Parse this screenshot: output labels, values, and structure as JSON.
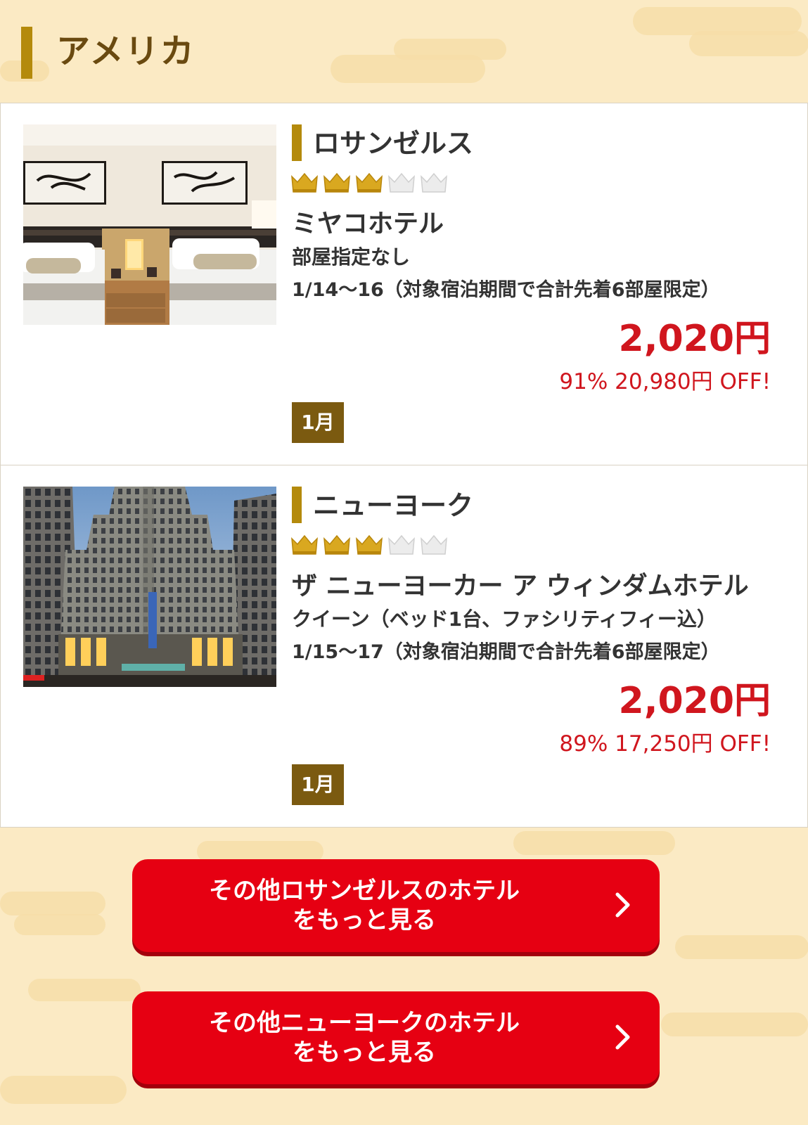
{
  "section": {
    "title": "アメリカ"
  },
  "colors": {
    "accent_gold": "#b48a0c",
    "price_red": "#d0161e",
    "button_red": "#e60012",
    "month_badge": "#7b5a10",
    "background": "#fbeac4"
  },
  "hotels": [
    {
      "city": "ロサンゼルス",
      "crowns": {
        "filled": 3,
        "total": 5
      },
      "name": "ミヤコホテル",
      "room": "部屋指定なし",
      "dates": "1/14〜16（対象宿泊期間で合計先着6部屋限定）",
      "price": "2,020円",
      "discount": "91% 20,980円 OFF!",
      "month": "1月",
      "photo_icon": "hotel-room-photo"
    },
    {
      "city": "ニューヨーク",
      "crowns": {
        "filled": 3,
        "total": 5
      },
      "name": "ザ ニューヨーカー ア ウィンダムホテル",
      "room": "クイーン（ベッド1台、ファシリティフィー込）",
      "dates": "1/15〜17（対象宿泊期間で合計先着6部屋限定）",
      "price": "2,020円",
      "discount": "89% 17,250円 OFF!",
      "month": "1月",
      "photo_icon": "hotel-building-photo"
    }
  ],
  "buttons": [
    {
      "line1": "その他ロサンゼルスのホテル",
      "line2": "をもっと見る"
    },
    {
      "line1": "その他ニューヨークのホテル",
      "line2": "をもっと見る"
    }
  ]
}
